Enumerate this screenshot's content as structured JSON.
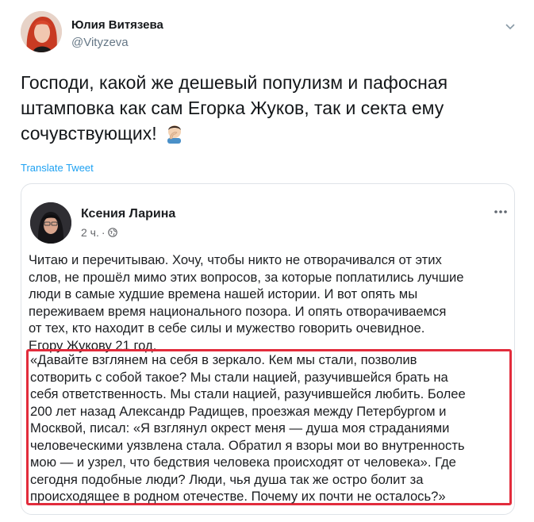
{
  "tweet": {
    "author_name": "Юлия Витязева",
    "author_handle": "@Vityzeva",
    "text": "Господи, какой же дешевый популизм и пафосная штамповка как сам Егорка Жуков, так и секта ему сочувствующих!",
    "emoji": "facepalm-icon",
    "translate_label": "Translate Tweet"
  },
  "embedded_post": {
    "author_name": "Ксения Ларина",
    "time": "2 ч.",
    "separator": "·",
    "privacy_icon": "globe-icon",
    "more_icon": "more-options-icon",
    "body_lines": [
      "Читаю и перечитываю. Хочу, чтобы никто не отворачивался от этих",
      "слов, не прошёл мимо этих вопросов, за которые поплатились лучшие",
      "люди в самые худшие времена нашей истории.   И вот опять мы",
      "переживаем время национального позора. И опять отворачиваемся",
      "от тех, кто находит в себе силы и мужество говорить очевидное.",
      "Егору Жукову 21 год."
    ],
    "quote_lines": [
      "«Давайте взглянем на себя в зеркало. Кем мы стали, позволив",
      "сотворить с собой такое? Мы стали нацией, разучившейся брать на",
      "себя ответственность. Мы стали нацией, разучившейся любить. Более",
      "200 лет назад Александр Радищев, проезжая между Петербургом и",
      "Москвой, писал: «Я взглянул окрест меня — душа моя страданиями",
      "человеческими уязвлена стала. Обратил я взоры мои во внутренность",
      "мою — и узрел, что бедствия человека происходят от человека». Где",
      "сегодня подобные люди? Люди, чья душа так же остро болит за",
      "происходящее в родном отечестве. Почему их почти не осталось?»"
    ],
    "highlight_color": "#e22c3c"
  },
  "colors": {
    "link": "#1da1f2",
    "handle": "#657786",
    "border": "#dfe3e8"
  }
}
